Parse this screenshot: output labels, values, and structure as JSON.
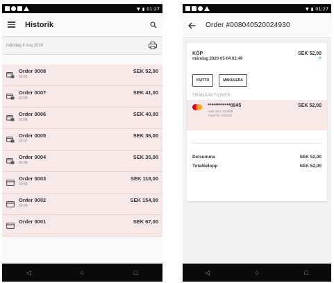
{
  "left": {
    "status_time": "01:27",
    "title": "Historik",
    "date": "måndag 4 maj 2020",
    "orders": [
      {
        "name": "Order 0008",
        "time": "02:56",
        "amount": "SEK 52,00",
        "bg": "pink",
        "icon": "receipt-icon"
      },
      {
        "name": "Order 0007",
        "time": "02:08",
        "amount": "SEK 41,00",
        "bg": "pink",
        "icon": "receipt-icon"
      },
      {
        "name": "Order 0006",
        "time": "02:08",
        "amount": "SEK 40,00",
        "bg": "pink",
        "icon": "receipt-icon"
      },
      {
        "name": "Order 0005",
        "time": "02:07",
        "amount": "SEK 36,00",
        "bg": "pink",
        "icon": "receipt-icon"
      },
      {
        "name": "Order 0004",
        "time": "02:06",
        "amount": "SEK 35,00",
        "bg": "pink",
        "icon": "receipt-icon"
      },
      {
        "name": "Order 0003",
        "time": "00:58",
        "amount": "SEK 118,00",
        "bg": "pink",
        "icon": "card-icon"
      },
      {
        "name": "Order 0002",
        "time": "00:54",
        "amount": "SEK 154,00",
        "bg": "pink",
        "icon": "card-icon"
      },
      {
        "name": "Order 0001",
        "time": "",
        "amount": "SEK 67,00",
        "bg": "pink",
        "icon": "card-icon"
      }
    ]
  },
  "right": {
    "status_time": "01:27",
    "title": "Order #008040520024930",
    "kop_label": "KÖP",
    "kop_amount": "SEK 52,00",
    "kop_date": "måndag 2020-05-04 02:49",
    "btn_kvitto": "KVITTO",
    "btn_makulera": "MAKULERA",
    "transaktioner_label": "TRANSAKTIONER",
    "card_number": "************0945",
    "auth_kod": "Aukt. kod: 123456",
    "trans_id": "Trans-ID: 000049",
    "trans_amount": "SEK 52,00",
    "delsumma_label": "Delsumma",
    "delsumma_value": "SEK 52,00",
    "total_label": "Totalbelopp",
    "total_value": "SEK 52,00"
  },
  "colors": {
    "row_pink": "#f7e9e7",
    "accent_blue": "#4a8bc2",
    "mastercard_red": "#e30613",
    "mastercard_orange": "#f79e1b"
  }
}
